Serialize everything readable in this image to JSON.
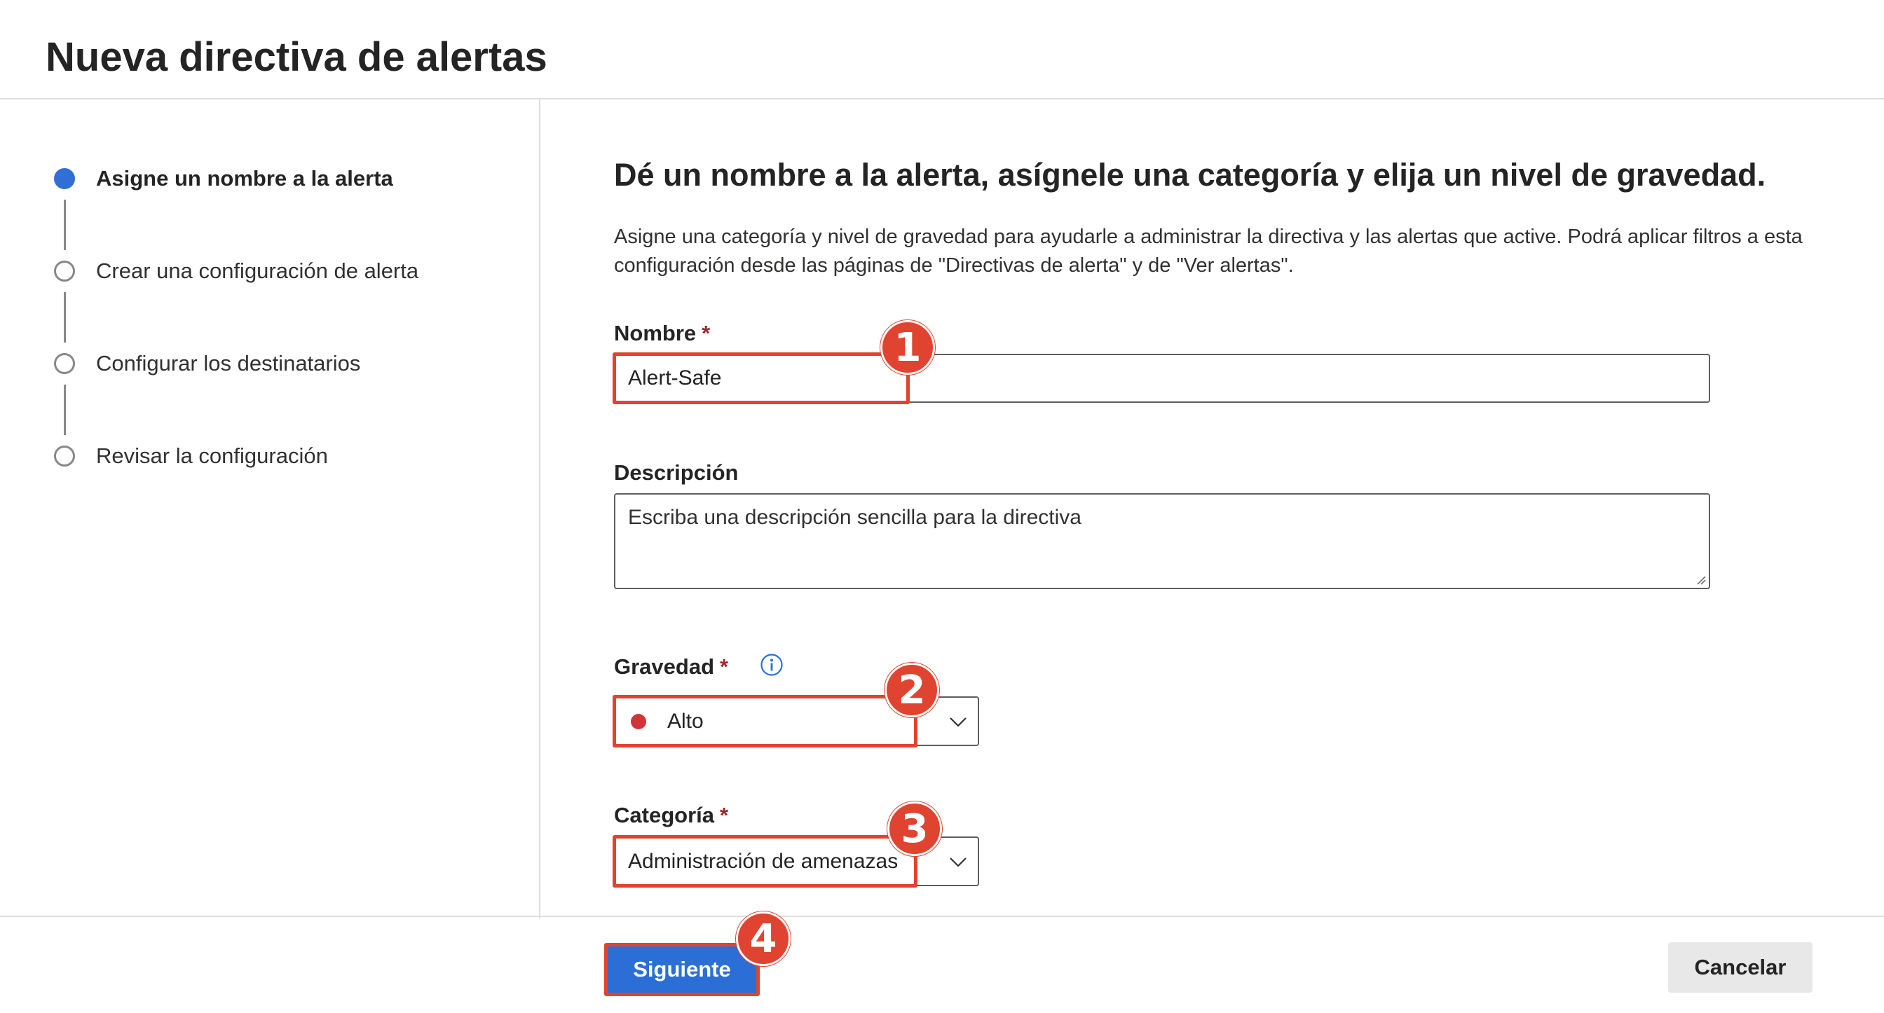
{
  "header": {
    "title": "Nueva directiva de alertas"
  },
  "stepper": {
    "steps": [
      {
        "label": "Asigne un nombre a la alerta",
        "state": "current"
      },
      {
        "label": "Crear una configuración de alerta",
        "state": "pending"
      },
      {
        "label": "Configurar los destinatarios",
        "state": "pending"
      },
      {
        "label": "Revisar la configuración",
        "state": "pending"
      }
    ]
  },
  "main": {
    "heading": "Dé un nombre a la alerta, asígnele una categoría y elija un nivel de gravedad.",
    "description": "Asigne una categoría y nivel de gravedad para ayudarle a administrar la directiva y las alertas que active. Podrá aplicar filtros a esta configuración desde las páginas de \"Directivas de alerta\" y de \"Ver alertas\".",
    "name_field": {
      "label": "Nombre",
      "required_mark": "*",
      "value": "Alert-Safe"
    },
    "description_field": {
      "label": "Descripción",
      "placeholder": "Escriba una descripción sencilla para la directiva"
    },
    "severity_field": {
      "label": "Gravedad",
      "required_mark": "*",
      "selected": "Alto",
      "dot_color": "#d13438",
      "info_icon": "info-icon"
    },
    "category_field": {
      "label": "Categoría",
      "required_mark": "*",
      "selected": "Administración de amenazas"
    }
  },
  "footer": {
    "next_label": "Siguiente",
    "cancel_label": "Cancelar"
  },
  "annotations": {
    "badge_1": "1",
    "badge_2": "2",
    "badge_3": "3",
    "badge_4": "4",
    "color": "#e0432f"
  },
  "colors": {
    "accent": "#2b6fd6",
    "required": "#a4262c"
  }
}
